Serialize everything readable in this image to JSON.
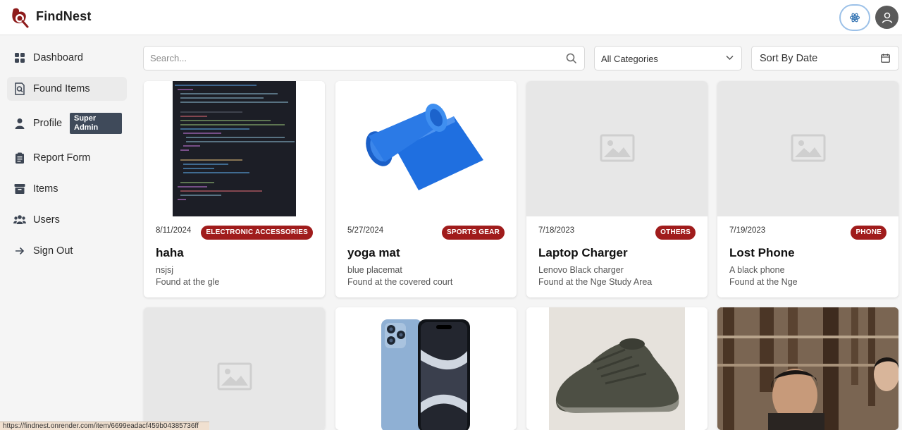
{
  "app": {
    "brand": "FindNest"
  },
  "sidebar": {
    "items": [
      {
        "label": "Dashboard"
      },
      {
        "label": "Found Items"
      },
      {
        "label": "Profile"
      },
      {
        "label": "Report Form"
      },
      {
        "label": "Items"
      },
      {
        "label": "Users"
      },
      {
        "label": "Sign Out"
      }
    ],
    "admin_badge": "Super Admin"
  },
  "filters": {
    "search_placeholder": "Search...",
    "category_selected": "All Categories",
    "sort_label": "Sort By Date"
  },
  "cards": [
    {
      "date": "8/11/2024",
      "tag": "ELECTRONIC ACCESSORIES",
      "title": "haha",
      "desc": "nsjsj",
      "location": "Found at the gle"
    },
    {
      "date": "5/27/2024",
      "tag": "SPORTS GEAR",
      "title": "yoga mat",
      "desc": "blue placemat",
      "location": "Found at the covered court"
    },
    {
      "date": "7/18/2023",
      "tag": "OTHERS",
      "title": "Laptop Charger",
      "desc": "Lenovo Black charger",
      "location": "Found at the Nge Study Area"
    },
    {
      "date": "7/19/2023",
      "tag": "PHONE",
      "title": "Lost Phone",
      "desc": "A black phone",
      "location": "Found at the Nge"
    }
  ],
  "status_url": "https://findnest.onrender.com/item/6699eadacf459b04385736ff",
  "colors": {
    "accent": "#a01c1c",
    "admin_badge": "#3f4a5a"
  }
}
